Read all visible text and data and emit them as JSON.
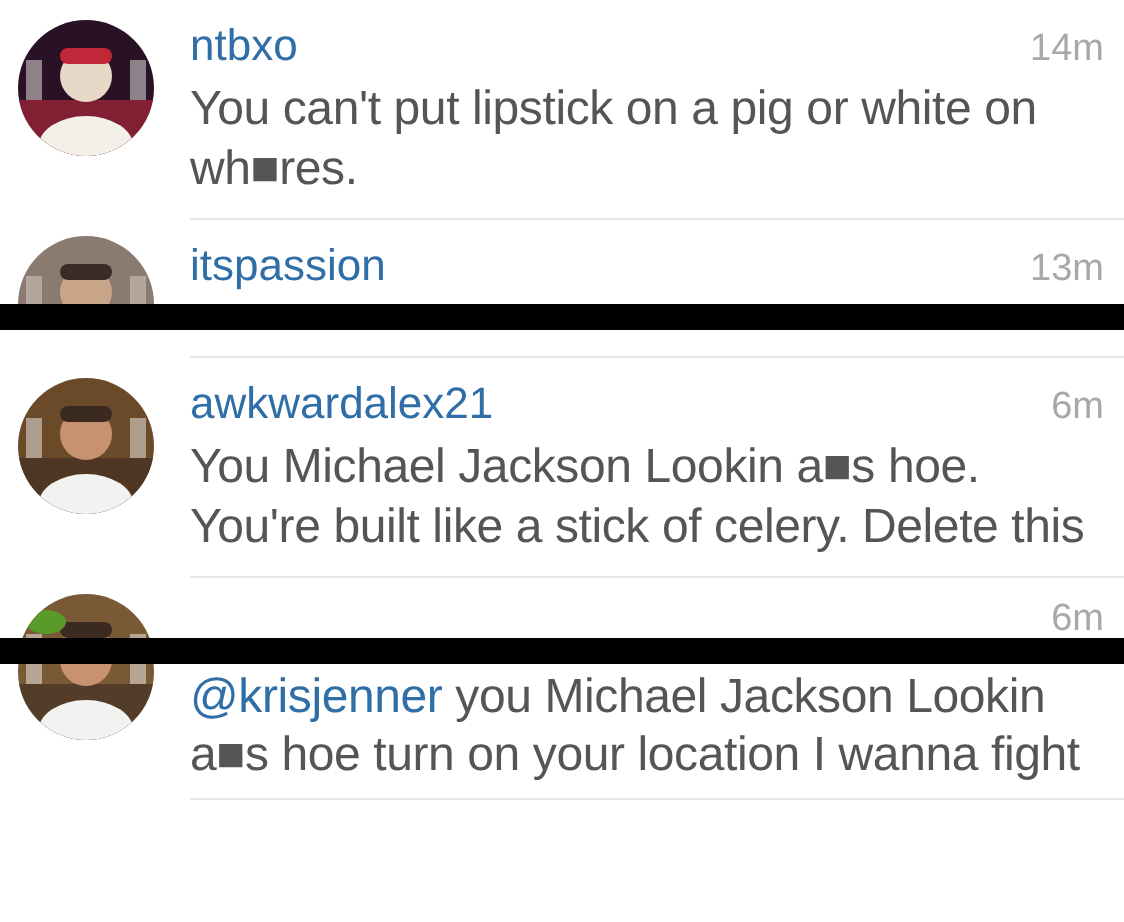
{
  "comments": [
    {
      "kind": "full",
      "username": "ntbxo",
      "time": "14m",
      "text": "You can't put lipstick on a pig or white on wh■res."
    },
    {
      "kind": "header",
      "username": "itspassion",
      "time": "13m"
    },
    {
      "kind": "bar"
    },
    {
      "kind": "full",
      "username": "awkwardalex21",
      "time": "6m",
      "text": "You Michael Jackson Lookin a■s hoe. You're built like a stick of celery. Delete this"
    },
    {
      "kind": "header",
      "time": "6m"
    },
    {
      "kind": "bar"
    },
    {
      "kind": "body",
      "mention": "@krisjenner",
      "text": "you Michael Jackson Lookin a■s hoe turn on your location I wanna fight"
    }
  ]
}
